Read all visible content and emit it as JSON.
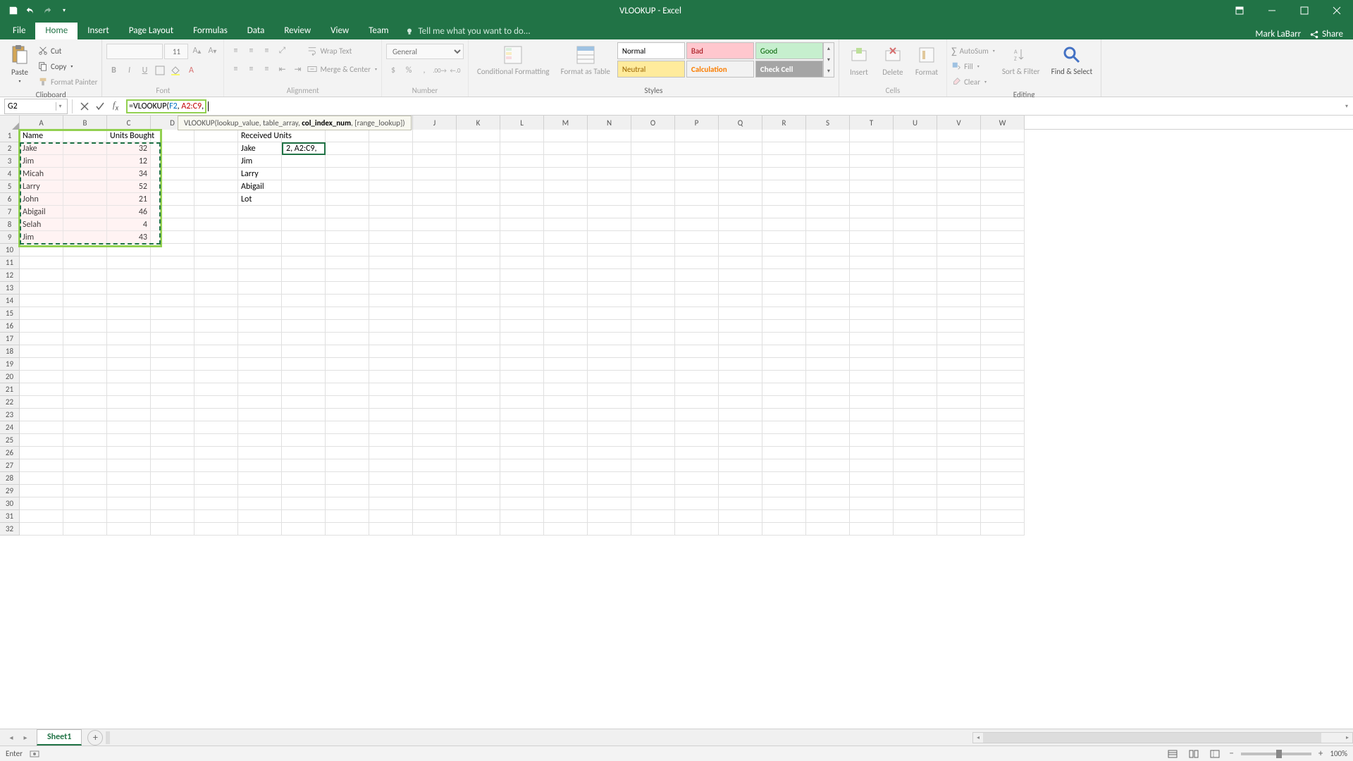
{
  "app": {
    "title": "VLOOKUP - Excel",
    "user": "Mark LaBarr",
    "share": "Share"
  },
  "tabs": {
    "file": "File",
    "home": "Home",
    "insert": "Insert",
    "pageLayout": "Page Layout",
    "formulas": "Formulas",
    "data": "Data",
    "review": "Review",
    "view": "View",
    "team": "Team",
    "tellMe": "Tell me what you want to do..."
  },
  "ribbon": {
    "clipboard": {
      "label": "Clipboard",
      "paste": "Paste",
      "cut": "Cut",
      "copy": "Copy",
      "formatPainter": "Format Painter"
    },
    "font": {
      "label": "Font",
      "name": "",
      "size": "11"
    },
    "alignment": {
      "label": "Alignment",
      "wrapText": "Wrap Text",
      "mergeCenter": "Merge & Center"
    },
    "number": {
      "label": "Number",
      "format": "General"
    },
    "styles": {
      "label": "Styles",
      "conditional": "Conditional Formatting",
      "formatAs": "Format as Table",
      "gallery": {
        "normal": "Normal",
        "bad": "Bad",
        "good": "Good",
        "neutral": "Neutral",
        "calculation": "Calculation",
        "checkCell": "Check Cell"
      }
    },
    "cells": {
      "label": "Cells",
      "insert": "Insert",
      "delete": "Delete",
      "format": "Format"
    },
    "editing": {
      "label": "Editing",
      "autoSum": "AutoSum",
      "fill": "Fill",
      "clear": "Clear",
      "sortFilter": "Sort & Filter",
      "findSelect": "Find & Select"
    }
  },
  "formulaBar": {
    "nameBox": "G2",
    "formula": {
      "prefix": "=VLOOKUP(",
      "arg1": "F2",
      "sep1": ", ",
      "arg2": "A2:C9",
      "sep2": ","
    },
    "tooltip": {
      "name": "VLOOKUP",
      "args": "(lookup_value, table_array, ",
      "bold": "col_index_num",
      "rest": ", [range_lookup])"
    }
  },
  "sheet": {
    "columns": [
      "A",
      "B",
      "C",
      "D",
      "E",
      "F",
      "G",
      "H",
      "I",
      "J",
      "K",
      "L",
      "M",
      "N",
      "O",
      "P",
      "Q",
      "R",
      "S",
      "T",
      "U",
      "V",
      "W"
    ],
    "rowCount": 32,
    "headers": {
      "A1": "Name",
      "C1": "Units Bought",
      "F1": "Received Units"
    },
    "nameData": [
      "Jake",
      "Jim",
      "Micah",
      "Larry",
      "John",
      "Abigail",
      "Selah",
      "Jim"
    ],
    "unitsData": [
      "32",
      "12",
      "34",
      "52",
      "21",
      "46",
      "4",
      "43"
    ],
    "fNames": [
      "Jake",
      "Jim",
      "Larry",
      "Abigail",
      "Lot"
    ],
    "g2display": "2, A2:C9,",
    "activeSheet": "Sheet1"
  },
  "status": {
    "mode": "Enter",
    "zoom": "100%"
  }
}
